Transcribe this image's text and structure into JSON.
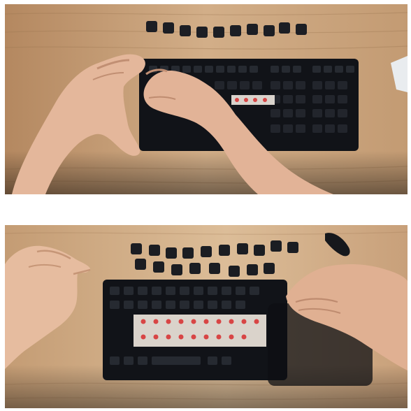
{
  "figure": {
    "panels": [
      {
        "id": "top",
        "scene": "hands-pressing-keycaps-onto-keyboard"
      },
      {
        "id": "bottom",
        "scene": "hands-removing-keycaps-exposing-red-switches"
      }
    ]
  },
  "colors": {
    "wood_light": "#c9a27a",
    "wood_dark": "#a57a52",
    "keyboard": "#14161b",
    "keycap": "#23262d",
    "switch_red": "#d94a4a",
    "skin": "#e3b69a",
    "skin_shadow": "#c08f74"
  }
}
